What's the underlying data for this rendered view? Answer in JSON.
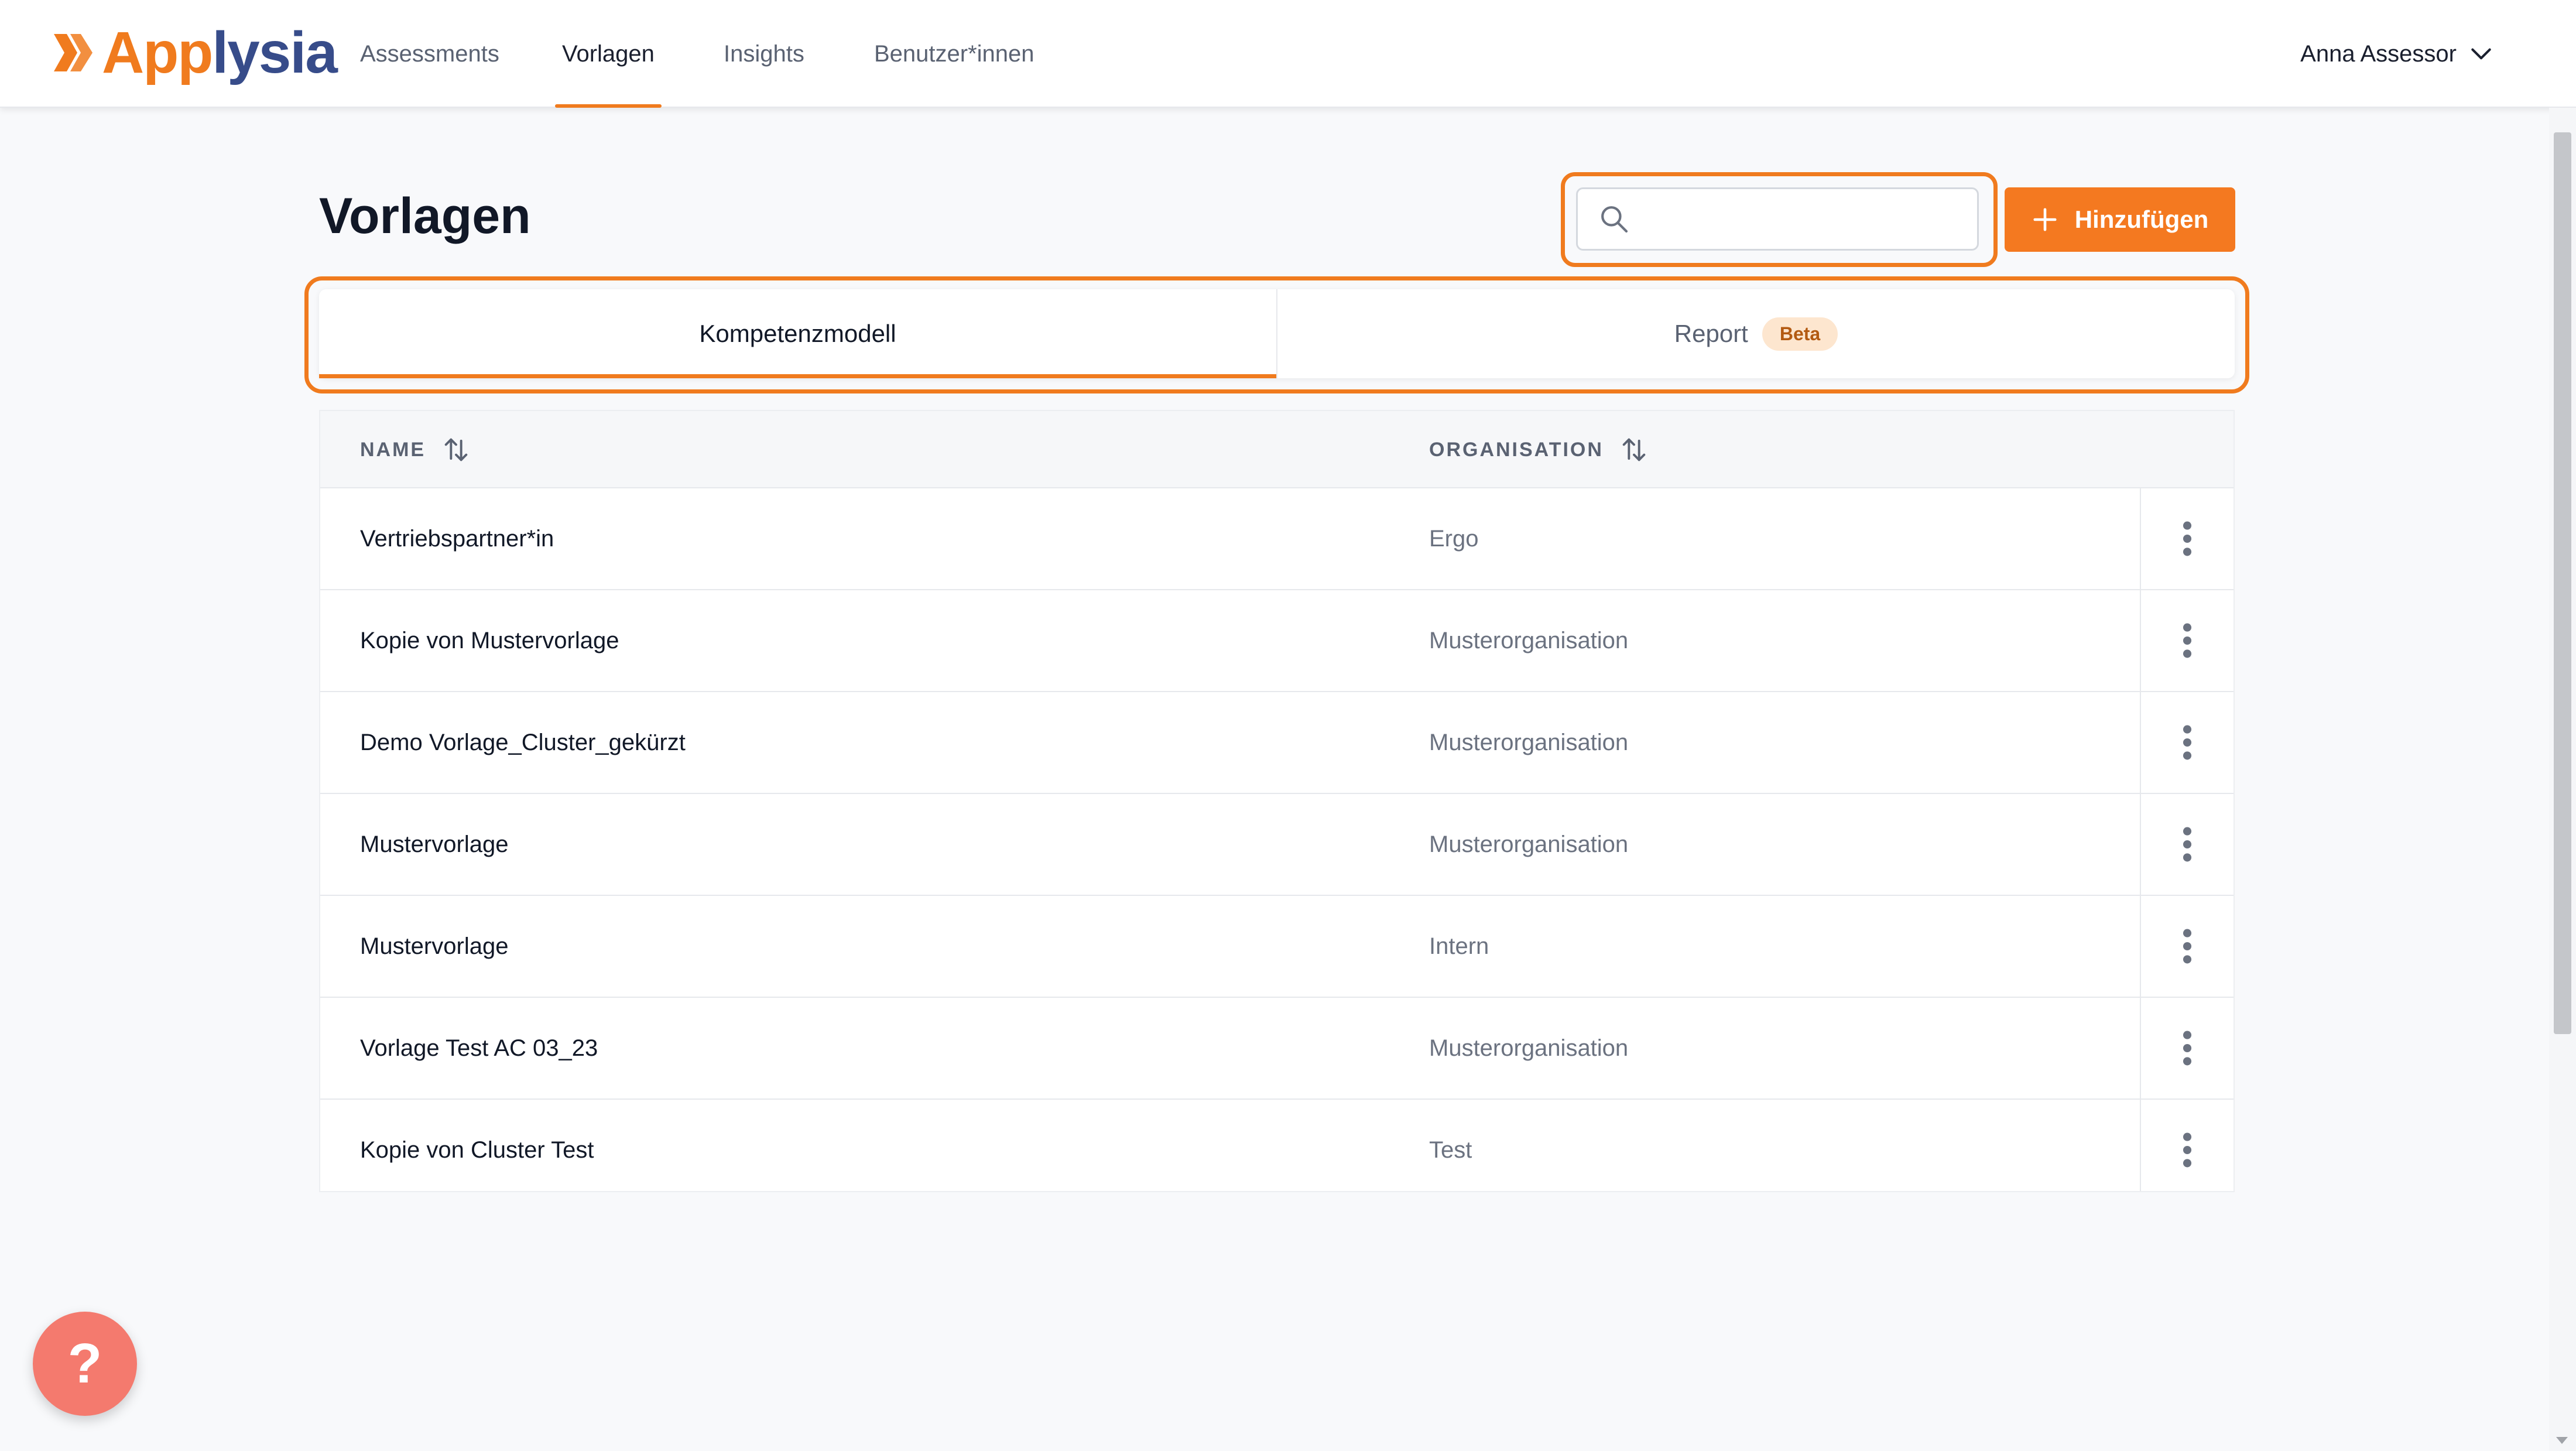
{
  "app": {
    "logo_part1": "App",
    "logo_part2": "lysia",
    "brand_color": "#f07b1e",
    "brand_secondary": "#374c8a"
  },
  "nav": {
    "items": [
      {
        "label": "Assessments",
        "active": false
      },
      {
        "label": "Vorlagen",
        "active": true
      },
      {
        "label": "Insights",
        "active": false
      },
      {
        "label": "Benutzer*innen",
        "active": false
      }
    ],
    "user_name": "Anna Assessor",
    "user_icon": "chevron-down-icon"
  },
  "page": {
    "title": "Vorlagen",
    "search_value": "",
    "search_icon": "search-icon",
    "add_button_label": "Hinzufügen",
    "add_icon": "plus-icon"
  },
  "tabs": [
    {
      "label": "Kompetenzmodell",
      "active": true
    },
    {
      "label": "Report",
      "badge": "Beta",
      "active": false
    }
  ],
  "table": {
    "columns": [
      {
        "label": "NAME",
        "sortable": true
      },
      {
        "label": "ORGANISATION",
        "sortable": true
      }
    ],
    "rows": [
      {
        "name": "Vertriebspartner*in",
        "organisation": "Ergo"
      },
      {
        "name": "Kopie von Mustervorlage",
        "organisation": "Musterorganisation"
      },
      {
        "name": "Demo Vorlage_Cluster_gekürzt",
        "organisation": "Musterorganisation"
      },
      {
        "name": "Mustervorlage",
        "organisation": "Musterorganisation"
      },
      {
        "name": "Mustervorlage",
        "organisation": "Intern"
      },
      {
        "name": "Vorlage Test AC 03_23",
        "organisation": "Musterorganisation"
      },
      {
        "name": "Kopie von Cluster Test",
        "organisation": "Test"
      }
    ]
  },
  "help": {
    "label": "?",
    "color": "#f47a6e"
  },
  "highlight_color": "#f07b1e"
}
